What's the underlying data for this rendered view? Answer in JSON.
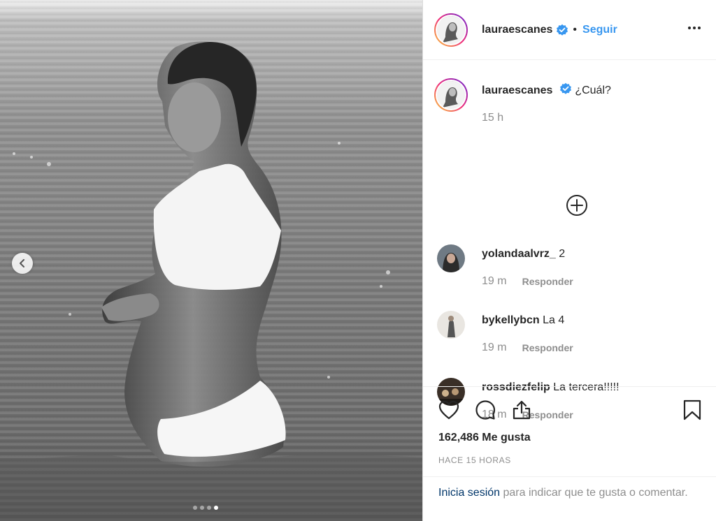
{
  "post": {
    "photo_alt": "",
    "carousel_total": 4,
    "carousel_active": 4
  },
  "header": {
    "username": "lauraescanes",
    "separator": "•",
    "follow_label": "Seguir"
  },
  "caption": {
    "username": "lauraescanes",
    "text": "¿Cuál?",
    "time": "15 h"
  },
  "comments": [
    {
      "username": "yolandaalvrz_",
      "text": "2",
      "time": "19 m",
      "reply_label": "Responder"
    },
    {
      "username": "bykellybcn",
      "text": "La 4",
      "time": "19 m",
      "reply_label": "Responder"
    },
    {
      "username": "rossdiezfelip",
      "text": "La tercera!!!!!",
      "time": "18 m",
      "reply_label": "Responder"
    }
  ],
  "stats": {
    "likes": "162,486 Me gusta",
    "posted_ago": "HACE 15 HORAS"
  },
  "login_prompt": {
    "link": "Inicia sesión",
    "rest": " para indicar que te gusta o comentar."
  },
  "icons": {
    "verified": "verified-badge-icon",
    "more": "more-options-icon",
    "add": "load-more-comments-icon",
    "like": "heart-icon",
    "comment": "comment-bubble-icon",
    "share": "share-icon",
    "save": "bookmark-icon",
    "prev": "chevron-left-icon"
  },
  "colors": {
    "accent": "#3897f0",
    "verified": "#3897f0",
    "muted": "#8e8e8e",
    "login_link": "#003569"
  }
}
